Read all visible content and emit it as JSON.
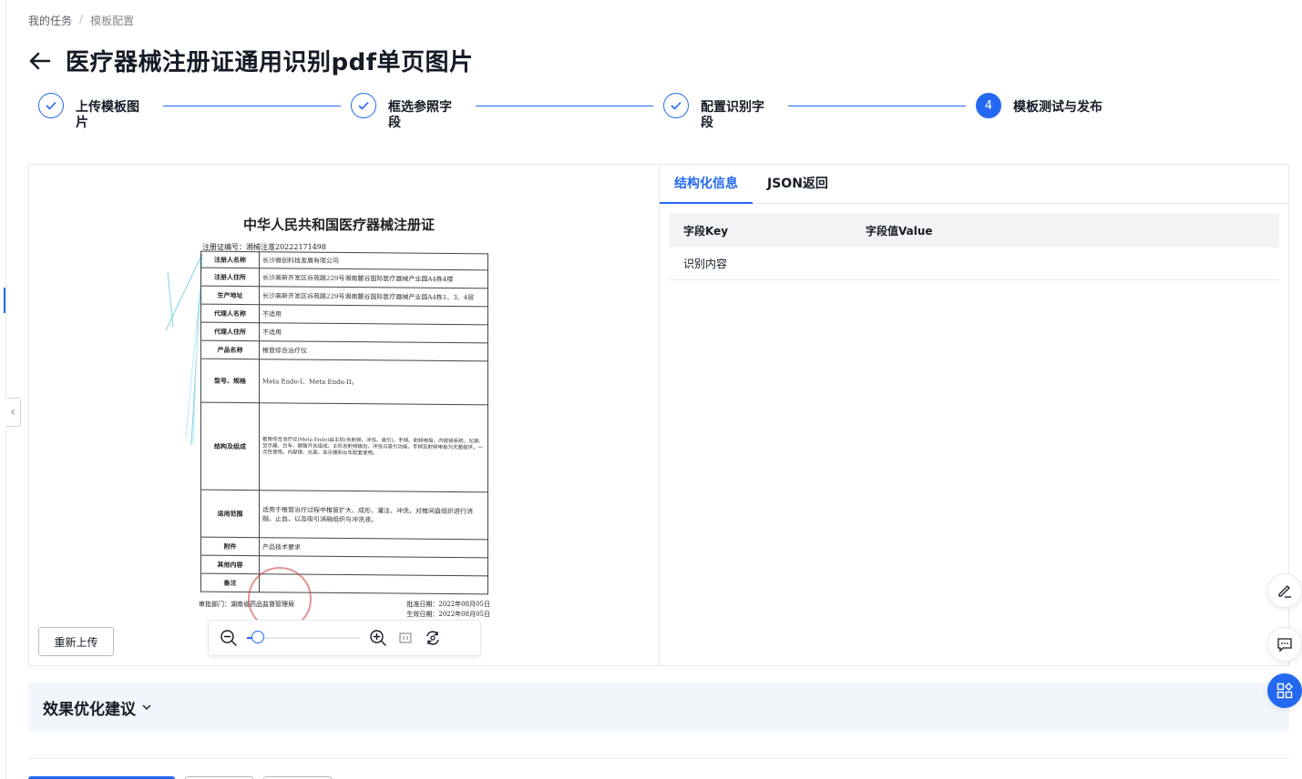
{
  "breadcrumb": {
    "parent": "我的任务",
    "separator": "/",
    "current": "模板配置"
  },
  "page": {
    "title": "医疗器械注册证通用识别pdf单页图片"
  },
  "steps": [
    {
      "label": "上传模板图片",
      "status": "done"
    },
    {
      "label": "框选参照字段",
      "status": "done"
    },
    {
      "label": "配置识别字段",
      "status": "done"
    },
    {
      "number": "4",
      "label": "模板测试与发布",
      "status": "active"
    }
  ],
  "document": {
    "title": "中华人民共和国医疗器械注册证",
    "reg_no": "注册证编号：湘械注准20222171498",
    "rows": [
      {
        "k": "注册人名称",
        "v": "长沙微创科技发展有限公司"
      },
      {
        "k": "注册人住所",
        "v": "长沙高新开发区谷苑路229号湘南麓谷国际医疗器械产业园A4栋4楼"
      },
      {
        "k": "生产地址",
        "v": "长沙高新开发区谷苑路229号湘南麓谷国际医疗器械产业园A4栋1、3、4层"
      },
      {
        "k": "代理人名称",
        "v": "不适用"
      },
      {
        "k": "代理人住所",
        "v": "不适用"
      },
      {
        "k": "产品名称",
        "v": "椎管综合治疗仪"
      },
      {
        "k": "型号、规格",
        "v": "Meta Endo-I、Meta Endo-II。"
      },
      {
        "k": "结构及组成",
        "v": "椎管综合治疗仪(Meta Endo)由主机(含射频、冲洗、吸引)、手柄、射频电极、内窥镜系统、光源、显示器、台车、脚踏开关组成。主机含射频输出、冲洗与吸引功能，手柄及射频电极为无菌提供，一次性使用。内窥镜、光源、显示器和台车配套使用。"
      },
      {
        "k": "适用范围",
        "v": "适用于椎管治疗过程中椎管扩大、成形、灌注、冲洗，对椎间盘组织进行消融、止血，以及吸引消融组织与冲洗液。"
      },
      {
        "k": "附件",
        "v": "产品技术要求"
      },
      {
        "k": "其他内容",
        "v": ""
      },
      {
        "k": "备注",
        "v": ""
      }
    ],
    "approval_dept": "审批部门：湖南省药品监督管理局",
    "approval_date": "批准日期：2022年08月05日",
    "effective_date": "生效日期：2022年08月05日"
  },
  "preview": {
    "reupload_label": "重新上传",
    "zoom_level": 0.1
  },
  "result": {
    "tabs": [
      {
        "label": "结构化信息",
        "active": true
      },
      {
        "label": "JSON返回",
        "active": false
      }
    ],
    "columns": {
      "key": "字段Key",
      "value": "字段值Value"
    },
    "rows": [
      {
        "key": "识别内容",
        "value": ""
      }
    ]
  },
  "suggest": {
    "title": "效果优化建议"
  },
  "colors": {
    "accent": "#2468f2",
    "text": "#151b26",
    "panel": "#f2f5fa"
  },
  "icons": {
    "back": "arrow-left-icon",
    "check": "check-icon",
    "zoom_out": "zoom-out-icon",
    "zoom_in": "zoom-in-icon",
    "fit": "fit-screen-icon",
    "reset": "reset-view-icon",
    "chevron": "chevron-down-icon",
    "edit": "edit-icon",
    "feedback": "message-icon",
    "apps": "apps-icon",
    "collapse": "chevron-left-icon"
  }
}
